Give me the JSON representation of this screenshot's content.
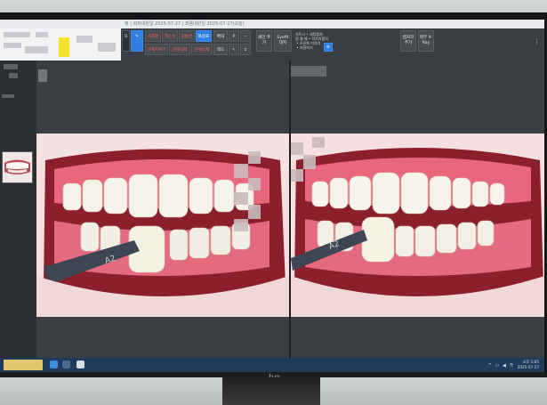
{
  "window": {
    "title": "정 | 회차내원일 2025-07-27 | 최종내원일 2025-07-27(오늘)"
  },
  "ribbon": {
    "tools": [
      {
        "id": "ruler",
        "label": "자"
      },
      {
        "id": "select",
        "label": "사레등"
      },
      {
        "id": "line",
        "label": "가는선"
      },
      {
        "id": "circle",
        "label": "원통선"
      },
      {
        "id": "arrow",
        "label": "화살표"
      },
      {
        "id": "delete-sel",
        "label": "선택지우기"
      },
      {
        "id": "delete-line",
        "label": "선택삭제"
      },
      {
        "id": "delete-all",
        "label": "전체삭제"
      },
      {
        "id": "zoom",
        "label": "확대"
      },
      {
        "id": "reset",
        "label": "액도"
      },
      {
        "id": "pen",
        "label": "P"
      },
      {
        "id": "dash",
        "label": "--"
      },
      {
        "id": "scale",
        "label": "↖"
      },
      {
        "id": "move",
        "label": "↕"
      },
      {
        "id": "add-new",
        "label": "새민 추가"
      },
      {
        "id": "eyefit",
        "label": "Eyefit 대지"
      },
      {
        "id": "capture-opts",
        "label": "치트시 • 세팅캡처\n원 결 제 • 치치치캡처\n • 오픈화 치치기\n • 저장하기"
      },
      {
        "id": "settings",
        "label": "⚙"
      },
      {
        "id": "capture-add",
        "label": "캡처코 추가"
      },
      {
        "id": "xray",
        "label": "외부 X-Ray"
      }
    ]
  },
  "tray": {
    "time": "오후 1:05",
    "date": "2025-07-27"
  },
  "photos": {
    "left_tab_label": "A2",
    "right_tab_label": "A2"
  },
  "colors": {
    "accent": "#2f7fe0",
    "toolbar_bg": "#3a3d41",
    "taskbar_bg": "#1f3a5a",
    "highlight": "#f4e22a"
  }
}
